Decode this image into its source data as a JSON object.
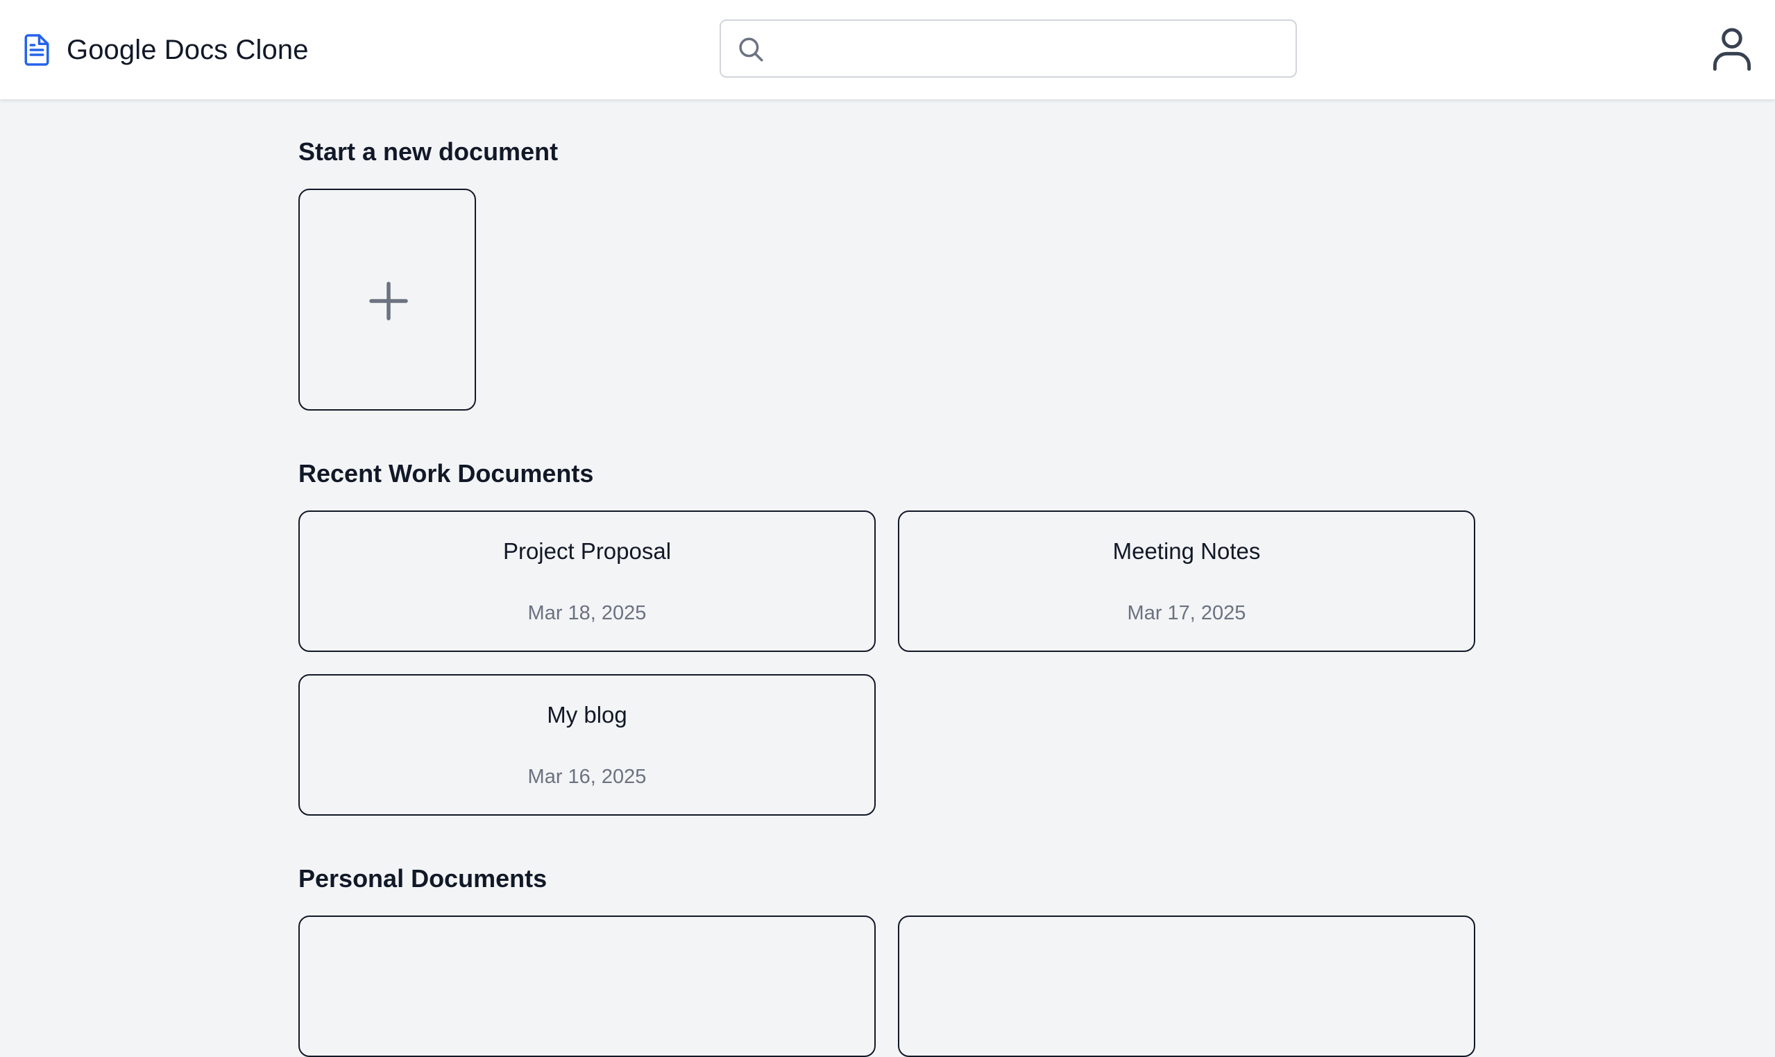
{
  "header": {
    "app_title": "Google Docs Clone",
    "logo_icon": "document-icon",
    "search": {
      "placeholder": "",
      "value": "",
      "icon": "search-icon"
    },
    "avatar_icon": "user-icon"
  },
  "new_document": {
    "section_title": "Start a new document",
    "icon": "plus-icon"
  },
  "recent_work": {
    "section_title": "Recent Work Documents",
    "documents": [
      {
        "title": "Project Proposal",
        "date": "Mar 18, 2025"
      },
      {
        "title": "Meeting Notes",
        "date": "Mar 17, 2025"
      },
      {
        "title": "My blog",
        "date": "Mar 16, 2025"
      }
    ]
  },
  "personal": {
    "section_title": "Personal Documents"
  },
  "colors": {
    "accent": "#2563eb",
    "background": "#f3f4f6",
    "card_border": "#111827",
    "muted_text": "#6b7280"
  }
}
